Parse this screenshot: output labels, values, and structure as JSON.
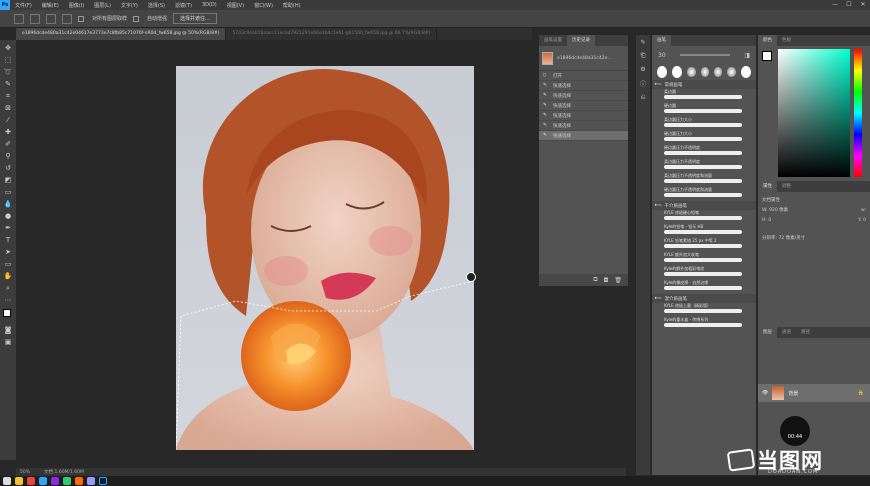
{
  "menubar": {
    "app_icon": "Ps",
    "items": [
      "文件(F)",
      "编辑(E)",
      "图像(I)",
      "图层(L)",
      "文字(Y)",
      "选择(S)",
      "滤镜(T)",
      "3D(D)",
      "视图(V)",
      "窗口(W)",
      "帮助(H)"
    ],
    "window_controls": [
      "—",
      "☐",
      "✕"
    ]
  },
  "options": {
    "sample_all_layers": "对所有图层取样",
    "auto_enhance": "自动增强",
    "select_subject": "选择并遮住..."
  },
  "tabs": [
    {
      "label": "e1896dcde480a31c42e04617e3773e7c8fb85c71076f-nR0d_fw658.jpg @ 50%(RGB/8#)",
      "active": true
    },
    {
      "label": "5743c9eab16aacc11ecad7921291e66e1bdc1e61-gb1560_fw658.jpg @ 66.7%(RGB/8#)",
      "active": false
    }
  ],
  "status": {
    "zoom": "50%",
    "doc": "文档:1.60M/1.60M"
  },
  "history": {
    "tabs": [
      "画笔设置",
      "历史记录"
    ],
    "snapshot": "e1896dcde48a31c42e...",
    "items": [
      "打开",
      "快速选择",
      "快速选择",
      "快速选择",
      "快速选择",
      "快速选择",
      "快速选择"
    ]
  },
  "brushes": {
    "title": "画笔",
    "size": "30",
    "groups": [
      {
        "name": "常规画笔",
        "items": [
          "柔边圆",
          "硬边圆",
          "柔边圆压力大小",
          "硬边圆压力大小",
          "硬边圆压力不透明度",
          "柔边圆压力不透明度",
          "柔边圆压力不透明度和流量",
          "硬边圆压力不透明度和流量"
        ]
      },
      {
        "name": "干介质画笔",
        "items": [
          "KYLE 终极硬心铅笔",
          "Kyle的铅笔 - 铅乐 HB",
          "KYLE 铅笔素描 25 px 中等 2",
          "KYLE 额外加大炭笔",
          "Kyle的额外加粗彩笔纹",
          "Kyle的橡皮擦 - 自然边缘"
        ]
      },
      {
        "name": "湿介质画笔",
        "items": [
          "KYLE 终极上墨（精彩版）",
          "Kyle的重水盒 - 传统系列"
        ]
      }
    ]
  },
  "color": {
    "tabs": [
      "颜色",
      "色板"
    ]
  },
  "properties": {
    "tabs": [
      "属性",
      "调整"
    ],
    "doc_props": "文档属性",
    "w_label": "W: 920 像素",
    "w_val": "w:",
    "h_label": "H: 0",
    "h_val": "Y: 0",
    "res": "分辨率: 72 像素/英寸"
  },
  "layers": {
    "tabs": [
      "图层",
      "通道",
      "路径"
    ],
    "layer_name": "背景"
  },
  "timer": "00:44",
  "watermark": {
    "text": "当图网",
    "sub": "DOADOAN.COM"
  },
  "colors": {
    "accent": "#31a8ff"
  }
}
